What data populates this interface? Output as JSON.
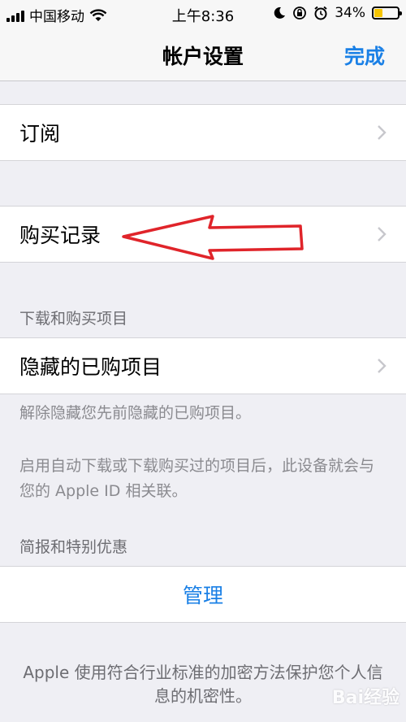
{
  "status_bar": {
    "carrier": "中国移动",
    "time": "上午8:36",
    "battery_percent": "34%",
    "battery_level": 0.34,
    "icons": [
      "signal-icon",
      "wifi-icon",
      "moon-icon",
      "orientation-lock-icon",
      "alarm-icon",
      "battery-icon"
    ]
  },
  "nav": {
    "title": "帐户设置",
    "done_label": "完成"
  },
  "cells": {
    "subscriptions": "订阅",
    "purchase_history": "购买记录",
    "hidden_purchases": "隐藏的已购项目",
    "manage": "管理"
  },
  "sections": {
    "downloads_header": "下载和购买项目",
    "hidden_footer": "解除隐藏您先前隐藏的已购项目。",
    "auto_download_footer": "启用自动下载或下载购买过的项目后，此设备就会与您的 Apple ID 相关联。",
    "newsletters_header": "简报和特别优惠",
    "privacy_note": "Apple 使用符合行业标准的加密方法保护您个人信息的机密性。"
  },
  "watermark": "Bai经验",
  "colors": {
    "accent": "#1a80e6",
    "background": "#efeff4",
    "annotation_arrow": "#e0242a",
    "battery": "#f5c400"
  }
}
